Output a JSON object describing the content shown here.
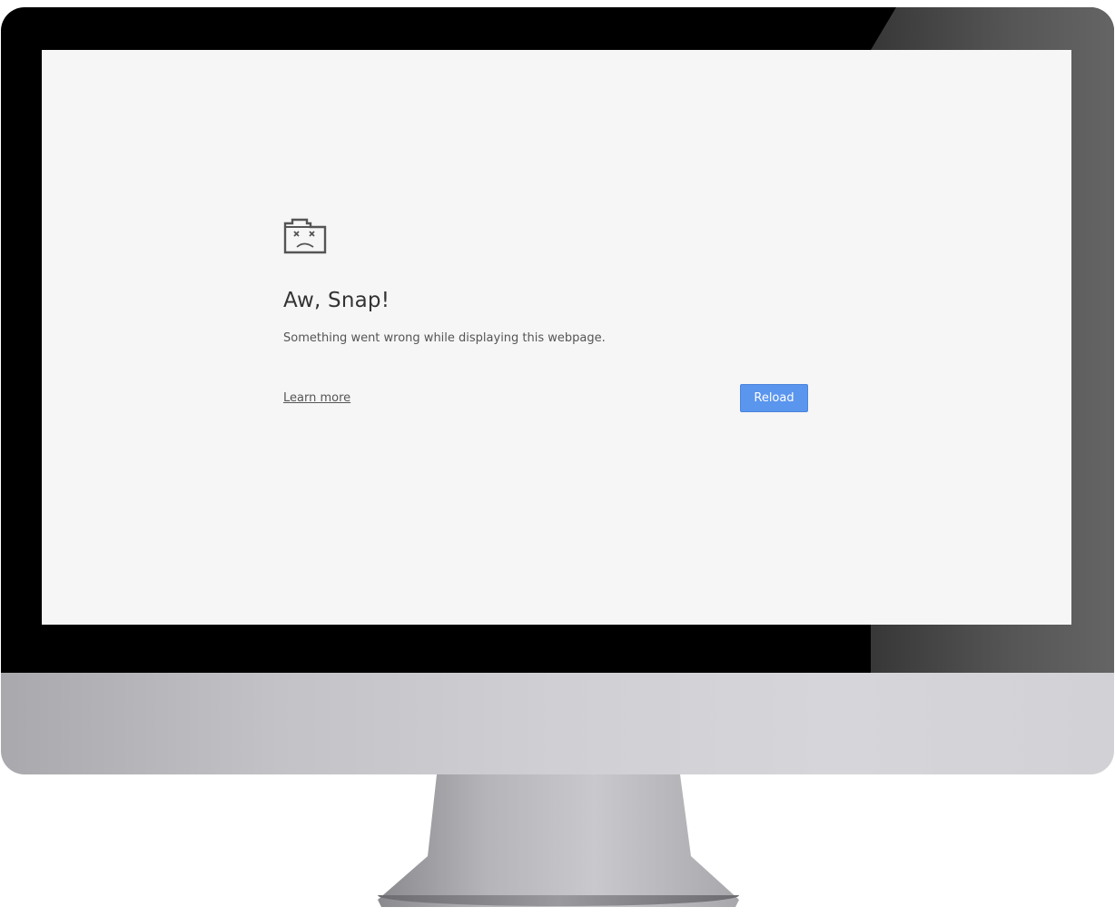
{
  "page": {
    "title": "Aw, Snap!",
    "message": "Something went wrong while displaying this webpage.",
    "learn_more_label": "Learn more",
    "reload_label": "Reload",
    "icon": "sad-tab-icon"
  },
  "colors": {
    "screen_background": "#f6f6f6",
    "reload_button": "#5a95ee",
    "title_text": "#333333",
    "body_text": "#555555",
    "bezel": "#000000",
    "chin": "#c8c8cc"
  }
}
